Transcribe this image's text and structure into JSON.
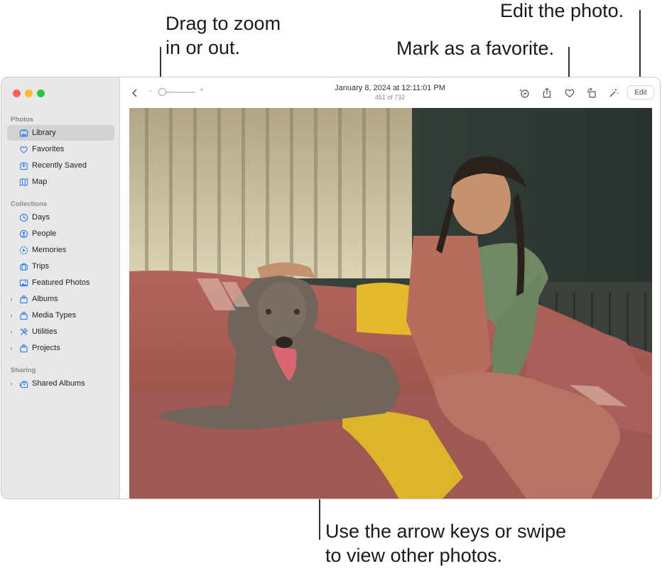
{
  "callouts": {
    "zoom": [
      "Drag to zoom",
      "in or out."
    ],
    "favorite": "Mark as a favorite.",
    "edit": "Edit the photo.",
    "navigate": [
      "Use the arrow keys or swipe",
      "to view other photos."
    ]
  },
  "window": {
    "traffic_lights": {
      "close": "#ff5f57",
      "minimize": "#febc2e",
      "zoom": "#28c840"
    }
  },
  "sidebar": {
    "sections": [
      {
        "label": "Photos",
        "items": [
          {
            "label": "Library",
            "icon": "library-icon",
            "selected": true
          },
          {
            "label": "Favorites",
            "icon": "heart-icon"
          },
          {
            "label": "Recently Saved",
            "icon": "recently-saved-icon"
          },
          {
            "label": "Map",
            "icon": "map-icon"
          }
        ]
      },
      {
        "label": "Collections",
        "items": [
          {
            "label": "Days",
            "icon": "clock-icon"
          },
          {
            "label": "People",
            "icon": "person-icon"
          },
          {
            "label": "Memories",
            "icon": "memories-icon"
          },
          {
            "label": "Trips",
            "icon": "suitcase-icon"
          },
          {
            "label": "Featured Photos",
            "icon": "photo-icon"
          },
          {
            "label": "Albums",
            "icon": "stack-icon",
            "expandable": true
          },
          {
            "label": "Media Types",
            "icon": "stack-icon",
            "expandable": true
          },
          {
            "label": "Utilities",
            "icon": "tools-icon",
            "expandable": true
          },
          {
            "label": "Projects",
            "icon": "stack-icon",
            "expandable": true
          }
        ]
      },
      {
        "label": "Sharing",
        "items": [
          {
            "label": "Shared Albums",
            "icon": "shared-albums-icon",
            "expandable": true
          }
        ]
      }
    ]
  },
  "toolbar": {
    "back": "‹",
    "zoom_minus": "−",
    "zoom_plus": "+",
    "zoom_level": 0.1,
    "title": "January 8, 2024 at 12:11:01 PM",
    "subtitle": "451 of 732",
    "edit_label": "Edit",
    "accent": "#2f7cf6"
  },
  "photo": {
    "description": "Girl in green turtleneck and pink overalls petting a gray dog on a pink sofa"
  }
}
